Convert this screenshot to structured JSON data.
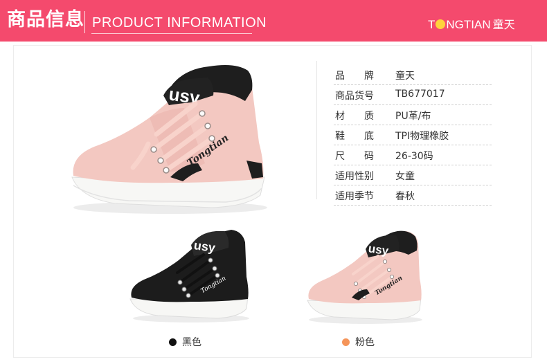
{
  "header": {
    "title_cn": "商品信息",
    "title_en": "PRODUCT INFORMATION",
    "brand_left": "T",
    "brand_right": "NGTIAN",
    "brand_cn": "童天",
    "background": "#f44a6d",
    "brand_dot_color": "#ffd23c"
  },
  "specs": [
    {
      "key": "品　　牌",
      "value": "童天"
    },
    {
      "key": "商品货号",
      "value": "TB677017"
    },
    {
      "key": "材　　质",
      "value": "PU革/布"
    },
    {
      "key": "鞋　　底",
      "value": "TPI物理橡胶"
    },
    {
      "key": "尺　　码",
      "value": "26-30码"
    },
    {
      "key": "适用性别",
      "value": "女童"
    },
    {
      "key": "适用季节",
      "value": "春秋"
    }
  ],
  "shoe_logo": "Tongtian",
  "shoe_tongue": "usy",
  "colors": [
    {
      "label": "黑色",
      "dot": "#111111",
      "icon": "black-dot-icon"
    },
    {
      "label": "粉色",
      "dot": "#f5955a",
      "icon": "orange-dot-icon"
    }
  ],
  "palette": {
    "pink_upper": "#f3c8c1",
    "pink_shadow": "#e7aca4",
    "black_upper": "#1c1c1c",
    "sole": "#f7f7f5"
  }
}
